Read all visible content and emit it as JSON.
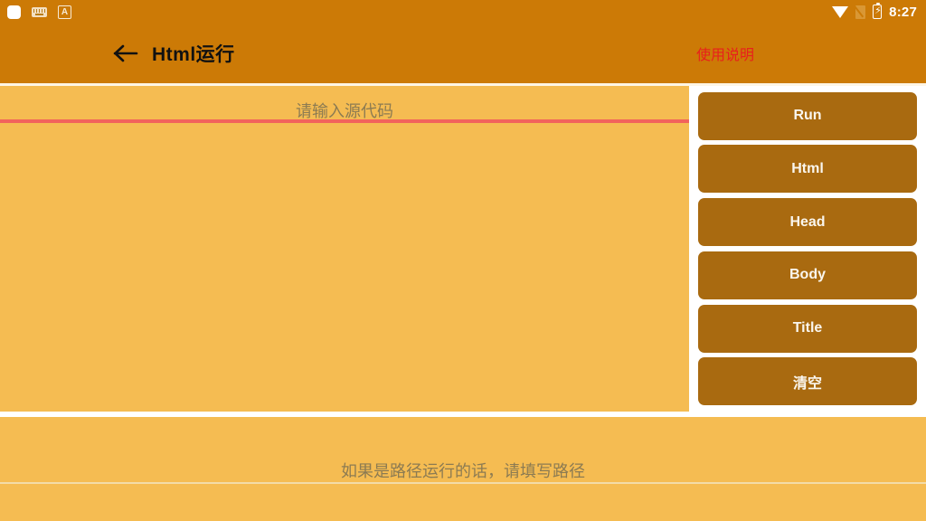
{
  "status_bar": {
    "left_icons": [
      {
        "name": "rounded-square-icon",
        "glyph": "square"
      },
      {
        "name": "keyboard-icon",
        "glyph": "keyboard"
      },
      {
        "name": "input-method-a-icon",
        "label": "A"
      }
    ],
    "right_icons": [
      {
        "name": "wifi-icon"
      },
      {
        "name": "sim-no-signal-icon"
      },
      {
        "name": "battery-charging-icon",
        "bolt": "⚡"
      }
    ],
    "time": "8:27"
  },
  "app_bar": {
    "back_icon": "←",
    "title": "Html运行",
    "help_label": "使用说明"
  },
  "editor": {
    "placeholder": "请输入源代码",
    "value": ""
  },
  "buttons": [
    {
      "id": "run",
      "label": "Run"
    },
    {
      "id": "html",
      "label": "Html"
    },
    {
      "id": "head",
      "label": "Head"
    },
    {
      "id": "body",
      "label": "Body"
    },
    {
      "id": "title",
      "label": "Title"
    },
    {
      "id": "clear",
      "label": "清空"
    }
  ],
  "path_field": {
    "placeholder": "如果是路径运行的话，请填写路径",
    "value": ""
  },
  "colors": {
    "app_bar": "#CC7A06",
    "background": "#F5BC52",
    "button": "#A96A10",
    "accent_underline": "#F2635C",
    "help_text": "#E8201C",
    "hint_text": "#8C7B52"
  }
}
